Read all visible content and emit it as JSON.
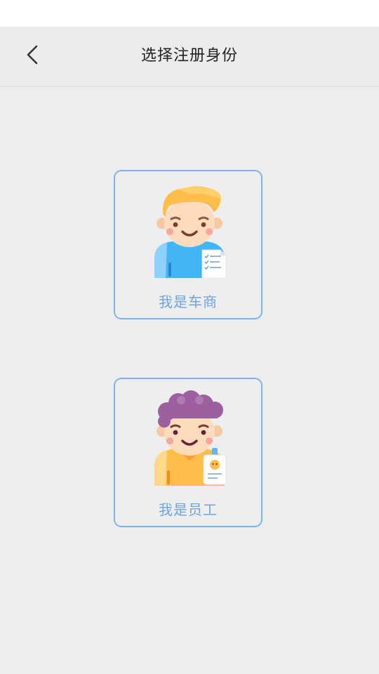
{
  "header": {
    "title": "选择注册身份"
  },
  "roles": [
    {
      "label": "我是车商",
      "icon": "dealer-avatar-icon"
    },
    {
      "label": "我是员工",
      "icon": "staff-avatar-icon"
    }
  ],
  "colors": {
    "background": "#ededed",
    "card_border": "#7fb2ee",
    "label": "#6ea3e4",
    "title": "#222222"
  }
}
